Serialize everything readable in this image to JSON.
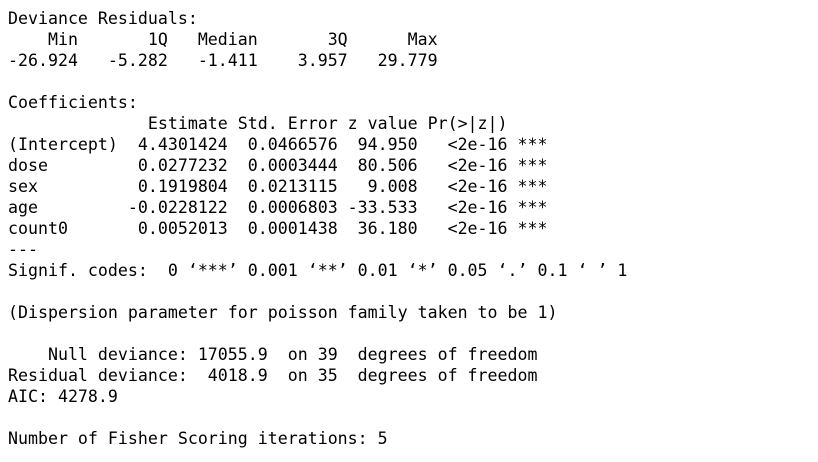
{
  "console": {
    "lines": [
      "Deviance Residuals: ",
      "    Min       1Q   Median       3Q      Max  ",
      "-26.924   -5.282   -1.411    3.957   29.779  ",
      "",
      "Coefficients:",
      "              Estimate Std. Error z value Pr(>|z|)    ",
      "(Intercept)  4.4301424  0.0466576  94.950   <2e-16 ***",
      "dose         0.0277232  0.0003444  80.506   <2e-16 ***",
      "sex          0.1919804  0.0213115   9.008   <2e-16 ***",
      "age         -0.0228122  0.0006803 -33.533   <2e-16 ***",
      "count0       0.0052013  0.0001438  36.180   <2e-16 ***",
      "---",
      "Signif. codes:  0 ‘***’ 0.001 ‘**’ 0.01 ‘*’ 0.05 ‘.’ 0.1 ‘ ’ 1",
      "",
      "(Dispersion parameter for poisson family taken to be 1)",
      "",
      "    Null deviance: 17055.9  on 39  degrees of freedom",
      "Residual deviance:  4018.9  on 35  degrees of freedom",
      "AIC: 4278.9",
      "",
      "Number of Fisher Scoring iterations: 5"
    ]
  }
}
